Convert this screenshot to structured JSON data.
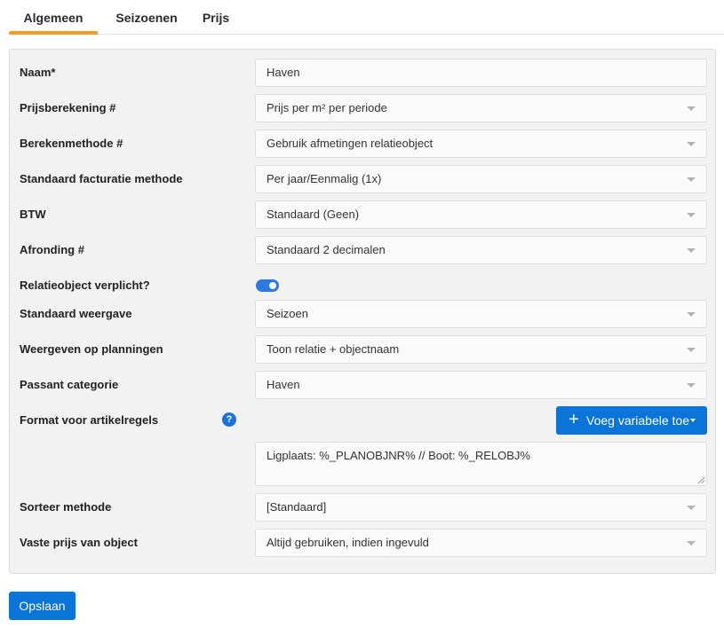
{
  "tabs": [
    {
      "label": "Algemeen",
      "active": true
    },
    {
      "label": "Seizoenen",
      "active": false
    },
    {
      "label": "Prijs",
      "active": false
    }
  ],
  "form": {
    "naam": {
      "label": "Naam*",
      "value": "Haven"
    },
    "prijsberekening": {
      "label": "Prijsberekening #",
      "value": "Prijs per m² per periode"
    },
    "berekenmethode": {
      "label": "Berekenmethode #",
      "value": "Gebruik afmetingen relatieobject"
    },
    "facturatie": {
      "label": "Standaard facturatie methode",
      "value": "Per jaar/Eenmalig (1x)"
    },
    "btw": {
      "label": "BTW",
      "value": "Standaard (Geen)"
    },
    "afronding": {
      "label": "Afronding #",
      "value": "Standaard 2 decimalen"
    },
    "relatieobject": {
      "label": "Relatieobject verplicht?",
      "checked": true
    },
    "weergave": {
      "label": "Standaard weergave",
      "value": "Seizoen"
    },
    "planningen": {
      "label": "Weergeven op planningen",
      "value": "Toon relatie + objectnaam"
    },
    "passant": {
      "label": "Passant categorie",
      "value": "Haven"
    },
    "format": {
      "label": "Format voor artikelregels",
      "help_symbol": "?",
      "add_button_plus": "+",
      "add_button_label": "Voeg variabele toe",
      "value": "Ligplaats: %_PLANOBJNR% // Boot: %_RELOBJ%"
    },
    "sorteer": {
      "label": "Sorteer methode",
      "value": "[Standaard]"
    },
    "vasteprijs": {
      "label": "Vaste prijs van object",
      "value": "Altijd gebruiken, indien ingevuld"
    }
  },
  "actions": {
    "save_label": "Opslaan"
  },
  "colors": {
    "accent": "#0a74d8",
    "tab_active": "#f39a2b",
    "toggle_on": "#2a7ae2"
  },
  "icons": {
    "help": "question-circle-icon",
    "add": "plus-icon",
    "dropdown": "caret-down-icon"
  }
}
